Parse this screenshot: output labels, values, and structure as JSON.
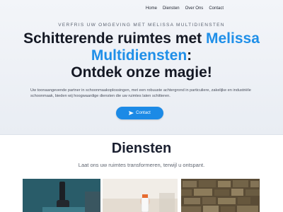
{
  "nav": {
    "items": [
      {
        "label": "Home"
      },
      {
        "label": "Diensten"
      },
      {
        "label": "Over Ons"
      },
      {
        "label": "Contact"
      }
    ]
  },
  "hero": {
    "tagline": "VERFRIS UW OMGEVING MET MELISSA MULTIDIENSTEN",
    "headline_part1": "Schitterende ruimtes met ",
    "headline_accent": "Melissa Multidiensten",
    "headline_colon": ":",
    "headline_line2": "Ontdek onze magie!",
    "intro": "Uw toonaangevende partner in schoonmaakoplossingen, met een robuuste achtergrond in particuliere, zakelijke en industriële schoonmaak, bieden wij hoogwaardige diensten die uw ruimtes laten schitteren.",
    "cta_label": "Contact"
  },
  "services": {
    "title": "Diensten",
    "subtitle": "Laat ons uw ruimtes transformeren, terwijl u ontspant."
  },
  "colors": {
    "accent": "#1f8fe8",
    "button": "#1c8ae6",
    "hero_bg": "#eef1f6"
  },
  "icons": {
    "cta": "send-icon"
  }
}
